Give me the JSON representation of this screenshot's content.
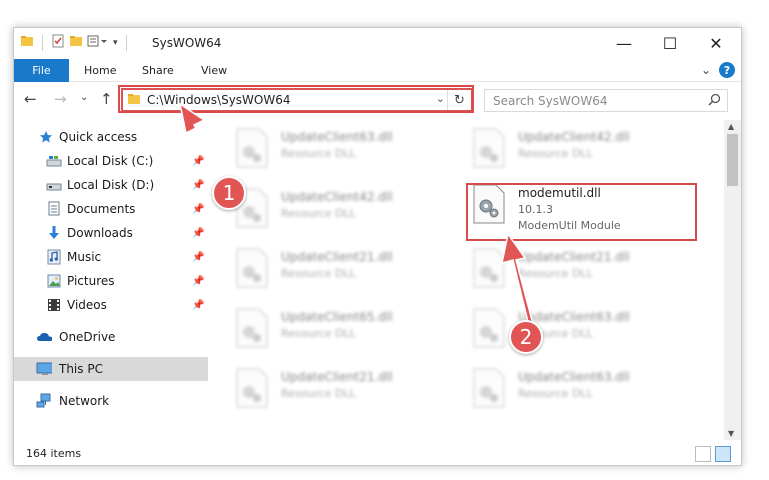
{
  "window": {
    "title": "SysWOW64",
    "controls": {
      "minimize": "—",
      "maximize": "☐",
      "close": "✕"
    }
  },
  "ribbon": {
    "tabs": [
      "File",
      "Home",
      "Share",
      "View"
    ],
    "expand_glyph": "⌄",
    "help_glyph": "?"
  },
  "navbar": {
    "back": "←",
    "forward": "→",
    "recent": "⌄",
    "up": "↑",
    "address": "C:\\Windows\\SysWOW64",
    "address_dropdown": "⌄",
    "refresh": "↻",
    "search_placeholder": "Search SysWOW64"
  },
  "sidebar": {
    "items": [
      {
        "label": "Quick access",
        "icon": "star-icon",
        "pinned": false
      },
      {
        "label": "Local Disk (C:)",
        "icon": "drive-icon",
        "pinned": true
      },
      {
        "label": "Local Disk (D:)",
        "icon": "drive-icon",
        "pinned": true
      },
      {
        "label": "Documents",
        "icon": "documents-icon",
        "pinned": true
      },
      {
        "label": "Downloads",
        "icon": "download-icon",
        "pinned": true
      },
      {
        "label": "Music",
        "icon": "music-icon",
        "pinned": true
      },
      {
        "label": "Pictures",
        "icon": "pictures-icon",
        "pinned": true
      },
      {
        "label": "Videos",
        "icon": "video-icon",
        "pinned": true
      },
      {
        "label": "OneDrive",
        "icon": "cloud-icon",
        "pinned": false
      },
      {
        "label": "This PC",
        "icon": "computer-icon",
        "pinned": false,
        "selected": true
      },
      {
        "label": "Network",
        "icon": "network-icon",
        "pinned": false
      }
    ],
    "pin_glyph": "📌"
  },
  "files": {
    "left_column": [
      {
        "name": "UpdateClient63.dll",
        "type": "Resource DLL"
      },
      {
        "name": "UpdateClient42.dll",
        "type": "Resource DLL"
      },
      {
        "name": "UpdateClient21.dll",
        "type": "Resource DLL"
      },
      {
        "name": "UpdateClient65.dll",
        "type": "Resource DLL"
      },
      {
        "name": "UpdateClient21.dll",
        "type": "Resource DLL"
      }
    ],
    "right_column": [
      {
        "name": "UpdateClient42.dll",
        "type": "Resource DLL"
      },
      {
        "name": "UpdateClient21.dll",
        "type": "Resource DLL"
      },
      {
        "name": "UpdateClient63.dll",
        "type": "Resource DLL"
      },
      {
        "name": "UpdateClient63.dll",
        "type": "Resource DLL"
      }
    ],
    "highlighted": {
      "name": "modemutil.dll",
      "version": "10.1.3",
      "description": "ModemUtil Module"
    }
  },
  "status": {
    "item_count": "164 items"
  },
  "callouts": {
    "one": "1",
    "two": "2"
  },
  "colors": {
    "accent": "#1979ca",
    "highlight": "#d94a4a",
    "callout": "#e25555"
  }
}
